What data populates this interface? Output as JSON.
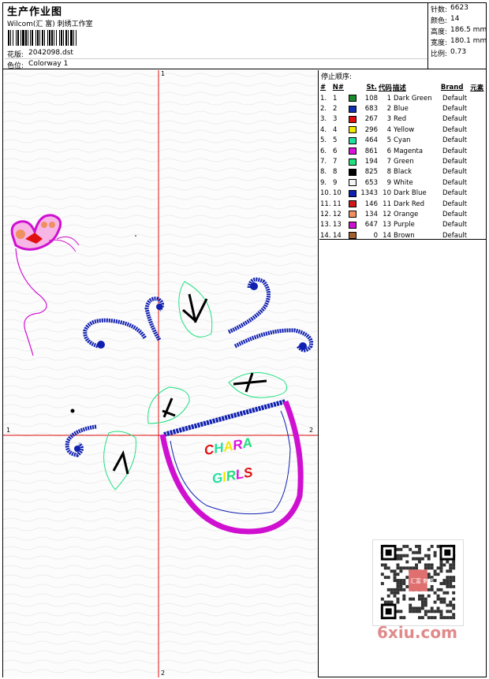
{
  "header": {
    "title": "生产作业图",
    "studio": "Wilcom(汇 富) 刺绣工作室",
    "design_label": "花版:",
    "design_value": "2042098.dst",
    "colorway_label": "色位:",
    "colorway_value": "Colorway 1"
  },
  "stats": [
    {
      "label": "针数:",
      "value": "6623"
    },
    {
      "label": "颜色:",
      "value": "14"
    },
    {
      "label": "高度:",
      "value": "186.5 mm"
    },
    {
      "label": "宽度:",
      "value": "180.1 mm"
    },
    {
      "label": "比例:",
      "value": "0.73"
    }
  ],
  "stop_sequence": {
    "title": "停止顺序:",
    "headers": {
      "idx": "#",
      "n": "N#",
      "st": "St.",
      "code": "代码",
      "desc": "描述",
      "brand": "Brand",
      "extra": "元素"
    },
    "rows": [
      {
        "idx": "1.",
        "n": "1",
        "color": "#1a8a2e",
        "st": "108",
        "code": "1",
        "desc": "Dark Green",
        "brand": "Default"
      },
      {
        "idx": "2.",
        "n": "2",
        "color": "#1030b0",
        "st": "683",
        "code": "2",
        "desc": "Blue",
        "brand": "Default"
      },
      {
        "idx": "3.",
        "n": "3",
        "color": "#e01010",
        "st": "267",
        "code": "3",
        "desc": "Red",
        "brand": "Default"
      },
      {
        "idx": "4.",
        "n": "4",
        "color": "#f0e800",
        "st": "296",
        "code": "4",
        "desc": "Yellow",
        "brand": "Default"
      },
      {
        "idx": "5.",
        "n": "5",
        "color": "#20e0a0",
        "st": "464",
        "code": "5",
        "desc": "Cyan",
        "brand": "Default"
      },
      {
        "idx": "6.",
        "n": "6",
        "color": "#e010e0",
        "st": "861",
        "code": "6",
        "desc": "Magenta",
        "brand": "Default"
      },
      {
        "idx": "7.",
        "n": "7",
        "color": "#20e080",
        "st": "194",
        "code": "7",
        "desc": "Green",
        "brand": "Default"
      },
      {
        "idx": "8.",
        "n": "8",
        "color": "#000000",
        "st": "825",
        "code": "8",
        "desc": "Black",
        "brand": "Default"
      },
      {
        "idx": "9.",
        "n": "9",
        "color": "#f4f4f4",
        "st": "653",
        "code": "9",
        "desc": "White",
        "brand": "Default"
      },
      {
        "idx": "10.",
        "n": "10",
        "color": "#1020b0",
        "st": "1343",
        "code": "10",
        "desc": "Dark Blue",
        "brand": "Default"
      },
      {
        "idx": "11.",
        "n": "11",
        "color": "#d01818",
        "st": "146",
        "code": "11",
        "desc": "Dark Red",
        "brand": "Default"
      },
      {
        "idx": "12.",
        "n": "12",
        "color": "#f09060",
        "st": "134",
        "code": "12",
        "desc": "Orange",
        "brand": "Default"
      },
      {
        "idx": "13.",
        "n": "13",
        "color": "#d010d0",
        "st": "647",
        "code": "13",
        "desc": "Purple",
        "brand": "Default"
      },
      {
        "idx": "14.",
        "n": "14",
        "color": "#a06030",
        "st": "0",
        "code": "14",
        "desc": "Brown",
        "brand": "Default"
      }
    ]
  },
  "design": {
    "text_line1": "CHARA",
    "text_line2": "GIRLS",
    "text_line1_colors": [
      "#e01010",
      "#20e0a0",
      "#f0e800",
      "#e010e0",
      "#20e080"
    ],
    "text_line2_colors": [
      "#20e0a0",
      "#f0e800",
      "#20e080",
      "#e010e0",
      "#e01010"
    ],
    "axis_markers": {
      "top": "1",
      "bottom": "2",
      "left": "1",
      "right": "2"
    }
  },
  "watermark": "6xiu.com",
  "qr_stamp": "汇富 刺绣"
}
